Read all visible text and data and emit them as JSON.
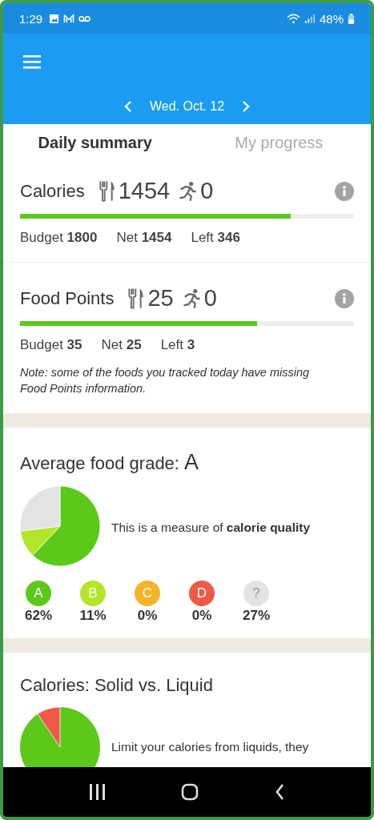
{
  "status_bar": {
    "time": "1:29",
    "battery": "48%"
  },
  "app_bar": {
    "date": "Wed. Oct. 12"
  },
  "tabs": [
    {
      "label": "Daily summary",
      "selected": true
    },
    {
      "label": "My progress",
      "selected": false
    }
  ],
  "trackers": [
    {
      "title": "Calories",
      "food": "1454",
      "exercise": "0",
      "level": 0.81,
      "stats": [
        "Budget **1800**",
        "Net **1454**",
        "Left **346**"
      ]
    },
    {
      "title": "Food Points",
      "food": "25",
      "exercise": "0",
      "level": 0.71,
      "stats": [
        "Budget **35**",
        "Net **25**",
        "Left **3**"
      ],
      "note": "Note: some of the foods you tracked today have missing Food Points information."
    }
  ],
  "grade_card": {
    "title": "Average food grade:",
    "grade": "A",
    "description": "This is a measure of **calorie quality**",
    "chart_data": {
      "type": "pie",
      "categories": [
        "A",
        "B",
        "C",
        "D",
        "?"
      ],
      "series": [
        {
          "values": [
            62,
            11,
            0,
            0,
            27
          ]
        }
      ]
    },
    "grades": [
      {
        "percent": "62%",
        "color": "#5cc91a"
      },
      {
        "percent": "11%",
        "color": "#b3e52a"
      },
      {
        "percent": "0%",
        "color": "#f5b42a"
      },
      {
        "percent": "0%",
        "color": "#ef5a47"
      },
      {
        "percent": "27%",
        "color": "#e3e3e3"
      }
    ]
  },
  "liquid_card": {
    "title": "Calories: Solid vs. Liquid",
    "description": "Limit your calories from liquids, they"
  }
}
